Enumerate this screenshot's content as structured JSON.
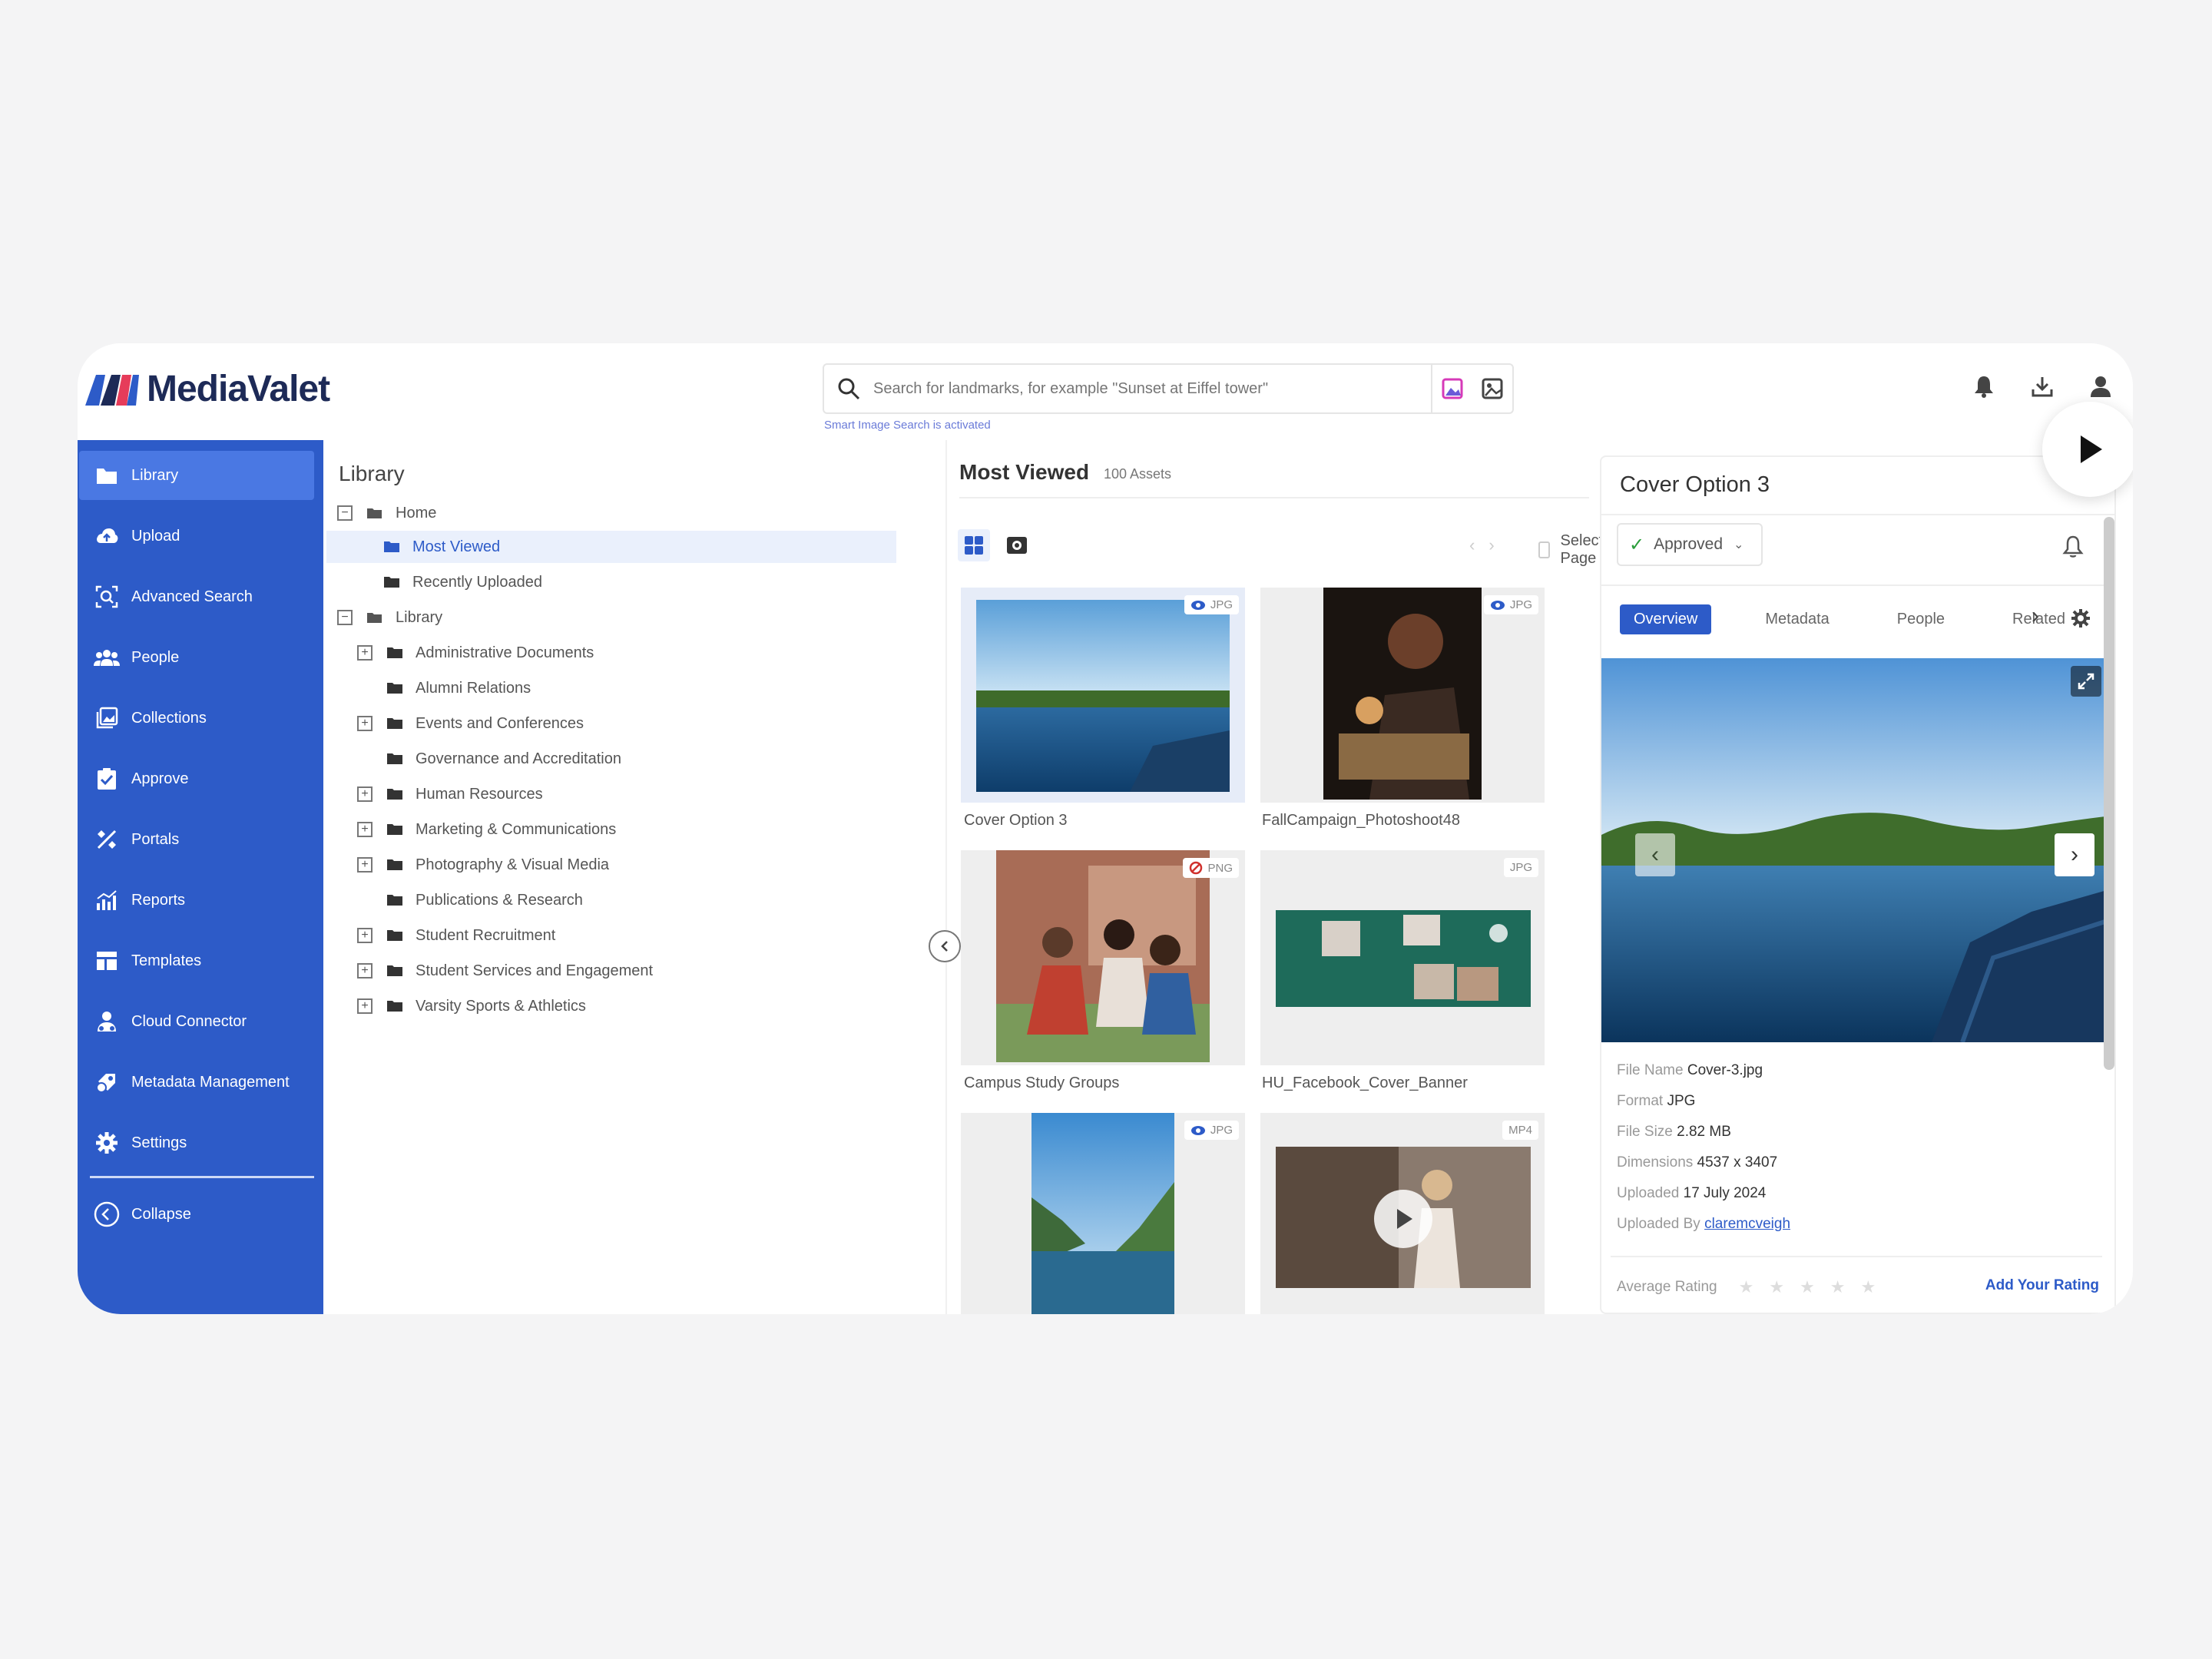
{
  "brand": {
    "name": "MediaValet"
  },
  "search": {
    "placeholder": "Search for landmarks, for example \"Sunset at Eiffel tower\"",
    "note": "Smart Image Search is activated"
  },
  "sidebar": {
    "items": [
      {
        "label": "Library",
        "icon": "library-icon"
      },
      {
        "label": "Upload",
        "icon": "upload-cloud-icon"
      },
      {
        "label": "Advanced Search",
        "icon": "advanced-search-icon"
      },
      {
        "label": "People",
        "icon": "people-icon"
      },
      {
        "label": "Collections",
        "icon": "collections-icon"
      },
      {
        "label": "Approve",
        "icon": "approve-icon"
      },
      {
        "label": "Portals",
        "icon": "portals-icon"
      },
      {
        "label": "Reports",
        "icon": "reports-icon"
      },
      {
        "label": "Templates",
        "icon": "templates-icon"
      },
      {
        "label": "Cloud Connector",
        "icon": "cloud-connector-icon"
      },
      {
        "label": "Metadata Management",
        "icon": "metadata-icon"
      },
      {
        "label": "Settings",
        "icon": "gear-icon"
      }
    ],
    "collapse_label": "Collapse"
  },
  "tree": {
    "title": "Library",
    "home": "Home",
    "most_viewed": "Most Viewed",
    "recently_uploaded": "Recently Uploaded",
    "library": "Library",
    "folders": [
      "Administrative Documents",
      "Alumni Relations",
      "Events and Conferences",
      "Governance and Accreditation",
      "Human Resources",
      "Marketing & Communications",
      "Photography & Visual Media",
      "Publications & Research",
      "Student Recruitment",
      "Student Services and Engagement",
      "Varsity Sports & Athletics"
    ]
  },
  "grid": {
    "title": "Most Viewed",
    "count": "100 Assets",
    "select_page": "Select Page",
    "assets": [
      {
        "name": "Cover Option 3",
        "format": "JPG"
      },
      {
        "name": "FallCampaign_Photoshoot48",
        "format": "JPG"
      },
      {
        "name": "Campus Study Groups",
        "format": "PNG"
      },
      {
        "name": "HU_Facebook_Cover_Banner",
        "format": "JPG"
      },
      {
        "name": "",
        "format": "JPG"
      },
      {
        "name": "",
        "format": "MP4"
      }
    ]
  },
  "detail": {
    "title": "Cover Option 3",
    "status": "Approved",
    "tabs": [
      "Overview",
      "Metadata",
      "People",
      "Related"
    ],
    "file_name_label": "File Name",
    "file_name": "Cover-3.jpg",
    "format_label": "Format",
    "format": "JPG",
    "size_label": "File Size",
    "size": "2.82 MB",
    "dims_label": "Dimensions",
    "dims": "4537 x 3407",
    "uploaded_label": "Uploaded",
    "uploaded": "17 July 2024",
    "uploaded_by_label": "Uploaded By",
    "uploaded_by": "claremcveigh",
    "rating_label": "Average Rating",
    "add_rating": "Add Your Rating"
  },
  "colors": {
    "accent": "#2d5bc8",
    "brand_navy": "#1d2a57",
    "approved": "#2a9d3a"
  }
}
